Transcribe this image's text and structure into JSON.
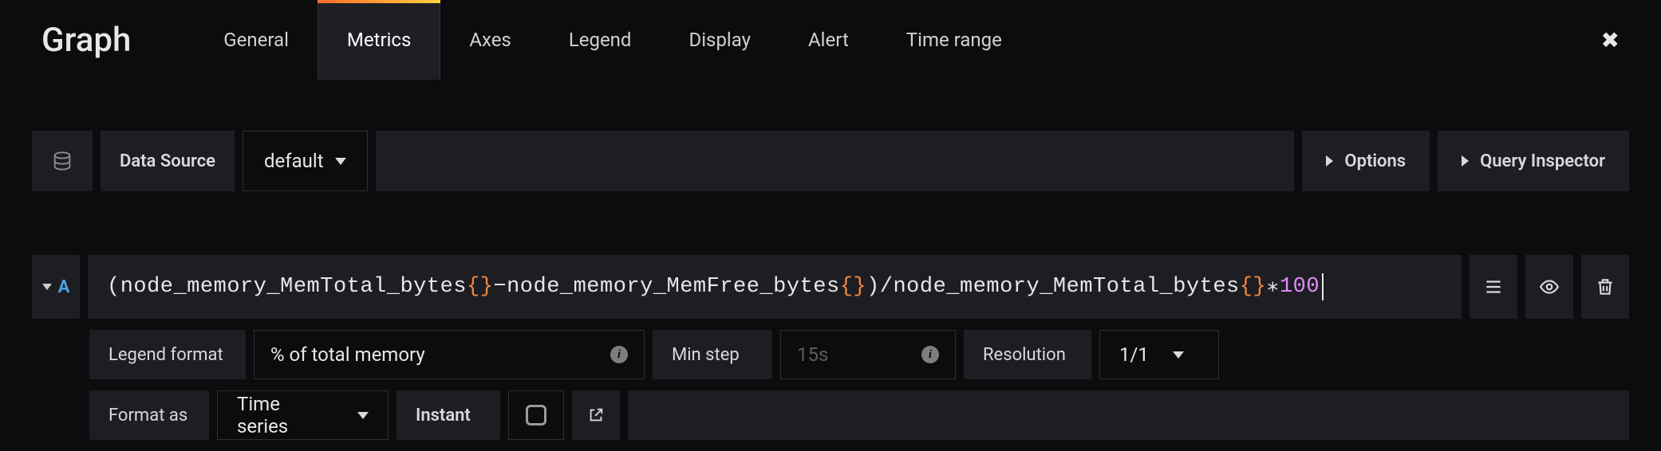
{
  "panel": {
    "title": "Graph"
  },
  "tabs": {
    "general": "General",
    "metrics": "Metrics",
    "axes": "Axes",
    "legend": "Legend",
    "display": "Display",
    "alert": "Alert",
    "timerange": "Time range",
    "active": "metrics"
  },
  "datasource": {
    "label": "Data Source",
    "value": "default"
  },
  "buttons": {
    "options": "Options",
    "inspector": "Query Inspector"
  },
  "query": {
    "letter": "A",
    "parts": {
      "open_paren": "(",
      "id1": "node_memory_MemTotal_bytes",
      "braces": "{}",
      "minus": " − ",
      "id2": "node_memory_MemFree_bytes",
      "close_paren": ")",
      "div": " / ",
      "id3": "node_memory_MemTotal_bytes",
      "mul": " ∗ ",
      "num": "100"
    }
  },
  "config": {
    "legend_format_label": "Legend format",
    "legend_format_value": "% of total memory",
    "min_step_label": "Min step",
    "min_step_placeholder": "15s",
    "resolution_label": "Resolution",
    "resolution_value": "1/1",
    "format_as_label": "Format as",
    "format_as_value": "Time series",
    "instant_label": "Instant"
  }
}
